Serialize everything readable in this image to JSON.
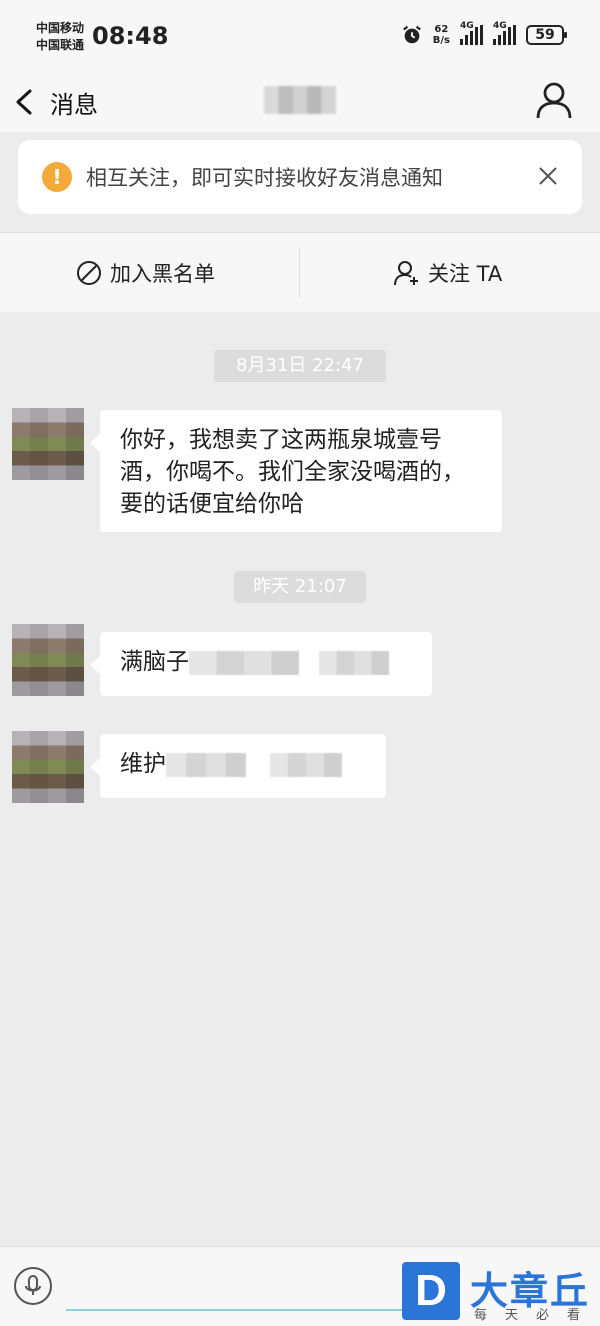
{
  "status_bar": {
    "carrier_1": "中国移动",
    "carrier_2": "中国联通",
    "time": "08:48",
    "net_speed_value": "62",
    "net_speed_unit": "B/s",
    "network_1": "4G",
    "network_2": "4G",
    "battery": "59"
  },
  "header": {
    "back_label": "消息"
  },
  "notice": {
    "text": "相互关注，即可实时接收好友消息通知"
  },
  "actions": {
    "block_label": "加入黑名单",
    "follow_label": "关注 TA"
  },
  "chat": {
    "timestamp_1": "8月31日 22:47",
    "message_1_line_1": "你好，我想卖了这两瓶泉城壹号",
    "message_1_line_2": "酒，你喝不。我们全家没喝酒的，",
    "message_1_line_3": "要的话便宜给你哈",
    "timestamp_2": "昨天 21:07",
    "message_2_visible": "满脑子",
    "message_3_visible": "维护"
  },
  "watermark": {
    "logo_letter": "D",
    "name": "大章丘",
    "slogan": "每天必看"
  },
  "colors": {
    "accent_blue": "#2b75d8",
    "warning_orange": "#f4a93b",
    "chat_background": "#ececec"
  }
}
